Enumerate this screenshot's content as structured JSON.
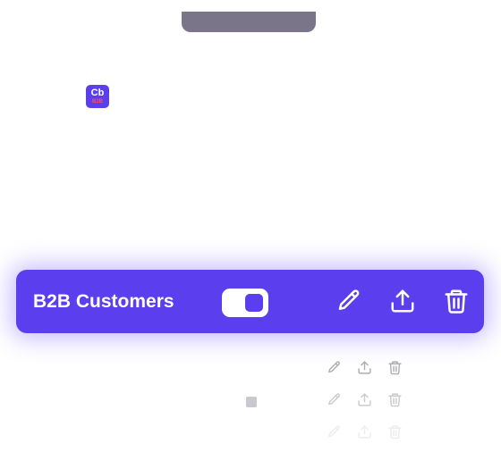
{
  "app_icon": {
    "big_text": "Cb",
    "small_text": "B2B"
  },
  "toolbar": {
    "title": "B2B Customers",
    "toggle_on": true,
    "accent_color": "#5b3fef",
    "edit_icon": "pencil-icon",
    "share_icon": "upload-icon",
    "delete_icon": "trash-icon"
  }
}
